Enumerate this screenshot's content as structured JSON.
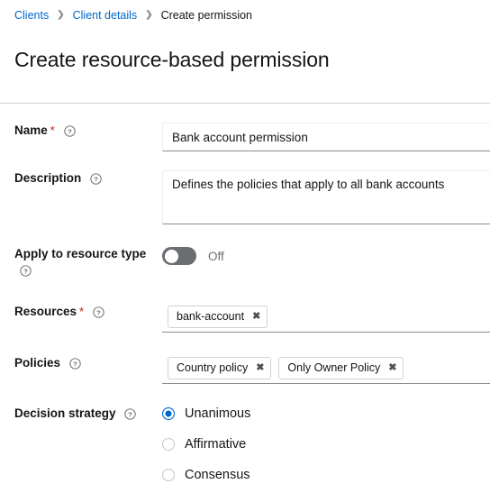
{
  "breadcrumb": {
    "items": [
      {
        "label": "Clients",
        "link": true
      },
      {
        "label": "Client details",
        "link": true
      },
      {
        "label": "Create permission",
        "link": false
      }
    ],
    "separator": "❯"
  },
  "page": {
    "title": "Create resource-based permission"
  },
  "form": {
    "name": {
      "label": "Name",
      "required_marker": "*",
      "help_icon": "help-circle-icon",
      "value": "Bank account permission",
      "placeholder": ""
    },
    "description": {
      "label": "Description",
      "help_icon": "help-circle-icon",
      "value": "Defines the policies that apply to all bank accounts",
      "placeholder": ""
    },
    "apply_to_resource_type": {
      "label": "Apply to resource type",
      "help_icon": "help-circle-icon",
      "state": "Off",
      "checked": false
    },
    "resources": {
      "label": "Resources",
      "required_marker": "*",
      "help_icon": "help-circle-icon",
      "chips": [
        {
          "label": "bank-account",
          "close_icon": "close-icon"
        }
      ],
      "placeholder": ""
    },
    "policies": {
      "label": "Policies",
      "help_icon": "help-circle-icon",
      "chips": [
        {
          "label": "Country policy",
          "close_icon": "close-icon"
        },
        {
          "label": "Only Owner Policy",
          "close_icon": "close-icon"
        }
      ],
      "placeholder": ""
    },
    "decision_strategy": {
      "label": "Decision strategy",
      "help_icon": "help-circle-icon",
      "selected": "Unanimous",
      "options": [
        {
          "label": "Unanimous",
          "selected": true
        },
        {
          "label": "Affirmative",
          "selected": false
        },
        {
          "label": "Consensus",
          "selected": false
        }
      ]
    }
  },
  "colors": {
    "link": "#0066cc",
    "accent": "#0066cc",
    "required": "#c9190b",
    "text": "#151515",
    "muted": "#6a6e73",
    "border": "#d2d2d2",
    "input_underline": "#8a8d90",
    "switch_off": "#6a6e73"
  }
}
